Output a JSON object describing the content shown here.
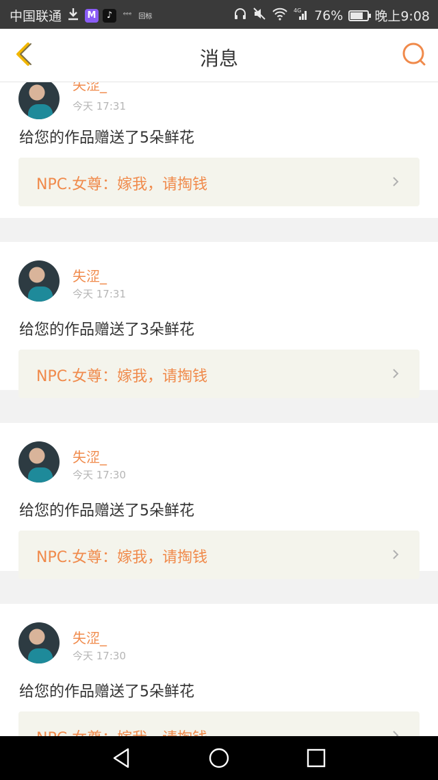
{
  "status_bar": {
    "carrier": "中国联通",
    "mini_1": "ᵉᵉᵉ",
    "mini_2": "回标",
    "network": "4G",
    "battery": "76%",
    "battery_level": 0.76,
    "time": "晚上9:08"
  },
  "header": {
    "title": "消息"
  },
  "messages": [
    {
      "username": "失涩_",
      "time": "今天 17:31",
      "text": "给您的作品赠送了5朵鲜花",
      "quote": "NPC.女尊：嫁我，请掏钱"
    },
    {
      "username": "失涩_",
      "time": "今天 17:31",
      "text": "给您的作品赠送了3朵鲜花",
      "quote": "NPC.女尊：嫁我，请掏钱"
    },
    {
      "username": "失涩_",
      "time": "今天 17:30",
      "text": "给您的作品赠送了5朵鲜花",
      "quote": "NPC.女尊：嫁我，请掏钱"
    },
    {
      "username": "失涩_",
      "time": "今天 17:30",
      "text": "给您的作品赠送了5朵鲜花",
      "quote": "NPC.女尊：嫁我，请掏钱"
    }
  ],
  "colors": {
    "accent": "#f08a4b",
    "back_icon": "#f2b700",
    "quote_bg": "#f4f4ec"
  },
  "icons": {
    "back": "chevron-left-icon",
    "search": "search-icon",
    "nav_back": "triangle-back-icon",
    "nav_home": "circle-home-icon",
    "nav_recent": "square-recent-icon"
  }
}
